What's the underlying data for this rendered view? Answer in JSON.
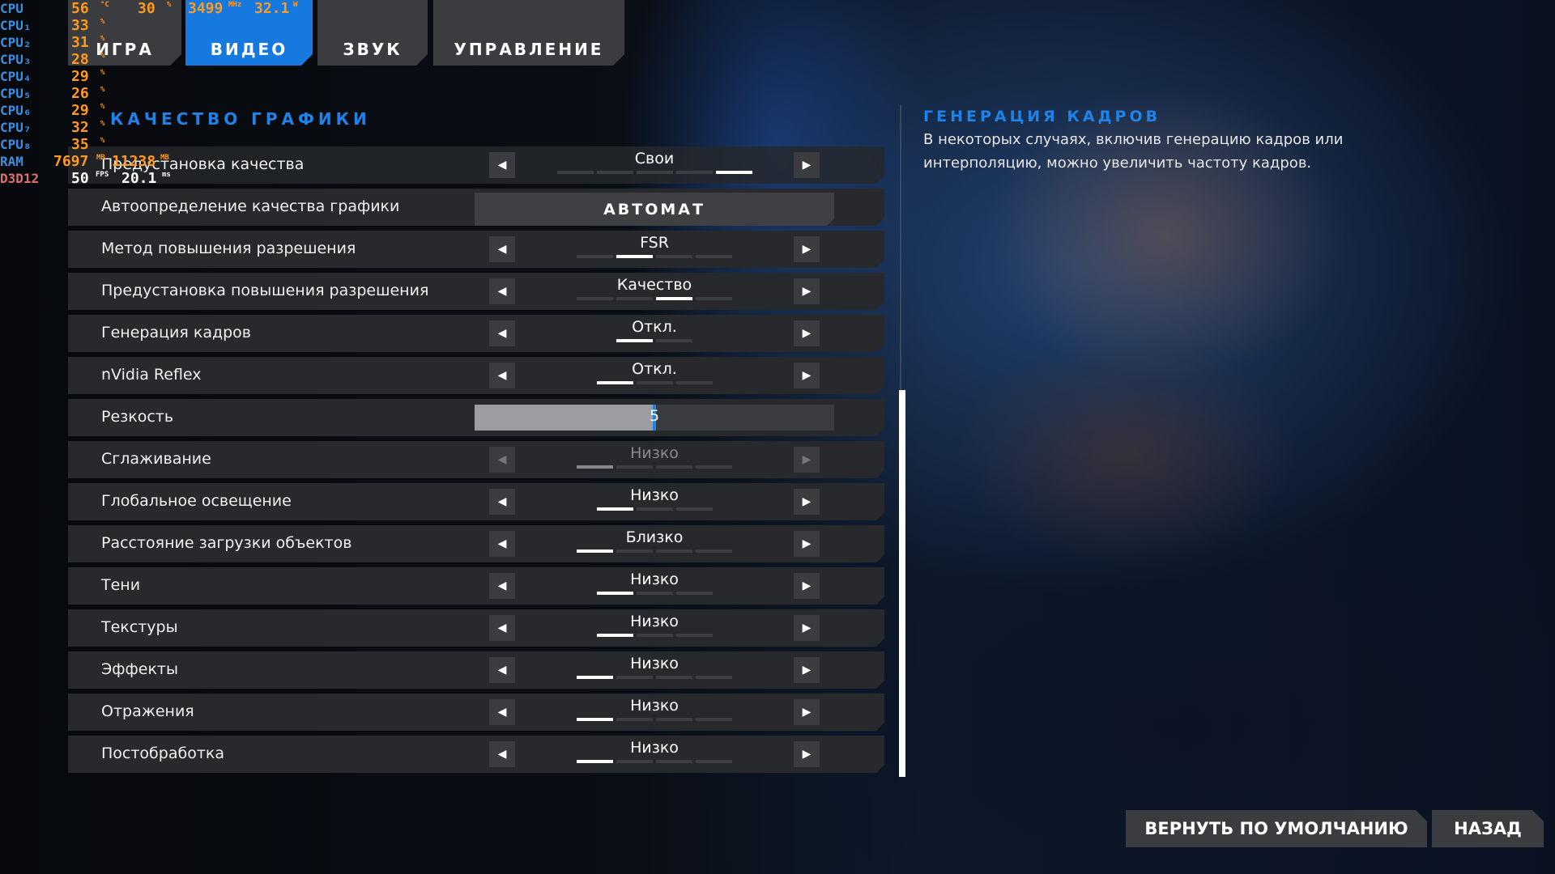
{
  "osd": {
    "rows": [
      {
        "label": "CPU",
        "v1": "56",
        "u1": "°C",
        "v2": "30",
        "u2": "%",
        "v3": "3499",
        "u3": "MHz",
        "v4": "32.1",
        "u4": "W"
      },
      {
        "label": "CPU₁",
        "v1": "33",
        "u1": "%"
      },
      {
        "label": "CPU₂",
        "v1": "31",
        "u1": "%"
      },
      {
        "label": "CPU₃",
        "v1": "28",
        "u1": "%"
      },
      {
        "label": "CPU₄",
        "v1": "29",
        "u1": "%"
      },
      {
        "label": "CPU₅",
        "v1": "26",
        "u1": "%"
      },
      {
        "label": "CPU₆",
        "v1": "29",
        "u1": "%"
      },
      {
        "label": "CPU₇",
        "v1": "32",
        "u1": "%"
      },
      {
        "label": "CPU₈",
        "v1": "35",
        "u1": "%"
      },
      {
        "label": "RAM",
        "v1": "7697",
        "u1": "MB",
        "v2": "11238",
        "u2": "MB"
      },
      {
        "label": "D3D12",
        "v1": "50",
        "u1": "FPS",
        "v2": "20.1",
        "u2": "ms"
      }
    ]
  },
  "tabs": [
    {
      "label": "ИГРА",
      "active": false
    },
    {
      "label": "ВИДЕО",
      "active": true
    },
    {
      "label": "ЗВУК",
      "active": false
    },
    {
      "label": "УПРАВЛЕНИЕ",
      "active": false
    }
  ],
  "section_title": "КАЧЕСТВО ГРАФИКИ",
  "settings": [
    {
      "label": "Предустановка качества",
      "value": "Свои",
      "pips": 5,
      "selected": 4
    },
    {
      "label": "Автоопределение качества графики",
      "button": "АВТОМАТ"
    },
    {
      "label": "Метод повышения разрешения",
      "value": "FSR",
      "pips": 4,
      "selected": 1
    },
    {
      "label": "Предустановка повышения разрешения",
      "value": "Качество",
      "pips": 4,
      "selected": 2
    },
    {
      "label": "Генерация кадров",
      "value": "Откл.",
      "pips": 2,
      "selected": 0
    },
    {
      "label": "nVidia Reflex",
      "value": "Откл.",
      "pips": 3,
      "selected": 0
    },
    {
      "label": "Резкость",
      "slider": "5",
      "slider_fraction": 0.5
    },
    {
      "label": "Сглаживание",
      "value": "Низко",
      "pips": 4,
      "selected": 0,
      "disabled": true
    },
    {
      "label": "Глобальное освещение",
      "value": "Низко",
      "pips": 3,
      "selected": 0
    },
    {
      "label": "Расстояние загрузки объектов",
      "value": "Близко",
      "pips": 4,
      "selected": 0
    },
    {
      "label": "Тени",
      "value": "Низко",
      "pips": 3,
      "selected": 0
    },
    {
      "label": "Текстуры",
      "value": "Низко",
      "pips": 3,
      "selected": 0
    },
    {
      "label": "Эффекты",
      "value": "Низко",
      "pips": 4,
      "selected": 0
    },
    {
      "label": "Отражения",
      "value": "Низко",
      "pips": 4,
      "selected": 0
    },
    {
      "label": "Постобработка",
      "value": "Низко",
      "pips": 4,
      "selected": 0
    }
  ],
  "info": {
    "title": "ГЕНЕРАЦИЯ КАДРОВ",
    "text": "В некоторых случаях, включив генерацию кадров или интерполяцию, можно увеличить частоту кадров."
  },
  "buttons": {
    "reset": "ВЕРНУТЬ ПО УМОЛЧАНИЮ",
    "back": "НАЗАД"
  },
  "icons": {
    "left": "arrow-left-icon",
    "right": "arrow-right-icon"
  },
  "colors": {
    "accent": "#1e82e8",
    "osd_value": "#ff9a1f",
    "osd_label": "#3b8fe0"
  }
}
